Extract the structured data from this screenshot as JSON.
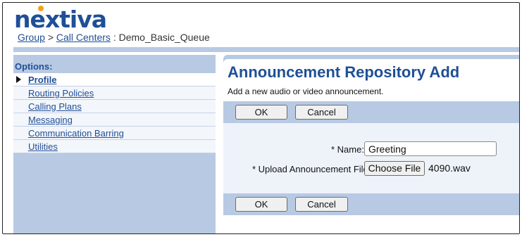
{
  "brand": {
    "logo_text": "nextiva",
    "logo_color": "#1f4f97",
    "logo_dot_color": "#f2a31b"
  },
  "breadcrumb": {
    "group": "Group",
    "separator": ">",
    "call_centers": "Call Centers",
    "colon": ":",
    "current": "Demo_Basic_Queue"
  },
  "sidebar": {
    "title": "Options:",
    "items": [
      {
        "label": "Profile",
        "active": true
      },
      {
        "label": "Routing Policies"
      },
      {
        "label": "Calling Plans"
      },
      {
        "label": "Messaging"
      },
      {
        "label": "Communication Barring"
      },
      {
        "label": "Utilities"
      }
    ]
  },
  "main": {
    "title": "Announcement Repository Add",
    "description": "Add a new audio or video announcement.",
    "buttons": {
      "ok": "OK",
      "cancel": "Cancel"
    },
    "form": {
      "name_label": "* Name:",
      "name_value": "Greeting",
      "upload_label": "* Upload Announcement File:",
      "choose_file": "Choose File",
      "file_name": "4090.wav"
    }
  },
  "colors": {
    "accent_bar": "#b8c9e3",
    "link": "#1f4f97"
  }
}
